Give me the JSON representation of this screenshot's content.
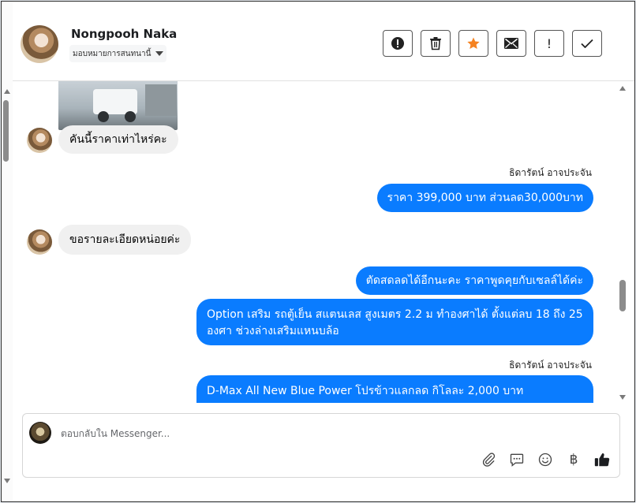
{
  "contact": {
    "name": "Nongpooh Naka",
    "assignment": "มอบหมายการสนทนานี้"
  },
  "toolbar": {
    "spam_label": "!",
    "important_label": "!"
  },
  "messages": {
    "in1": "คันนี้ราคาเท่าไหร่คะ",
    "sender1": "ธิดารัตน์ อาจประจัน",
    "out1": "ราคา 399,000 บาท ส่วนลด30,000บาท",
    "in2": "ขอรายละเอียดหน่อยค่ะ",
    "out2": "ตัดสดลดได้อีกนะคะ ราคาพูดคุยกับเซลล์ได้ค่ะ",
    "out3": "Option เสริม รถตู้เย็น สแตนเลส สูงเมตร 2.2 ม ทำองศาได้ ตั้งแต่ลบ 18 ถึง 25 องศา ช่วงล่างเสริมแหนบล้อ",
    "sender2": "ธิดารัตน์ อาจประจัน",
    "out4": "D-Max All New Blue Power โปรข้าวแลกลด กิโลละ 2,000 บาท"
  },
  "composer": {
    "placeholder": "ตอบกลับใน Messenger...",
    "currency_symbol": "฿"
  },
  "icons": {
    "toolbar": [
      "alert-circle-icon",
      "trash-icon",
      "star-icon",
      "envelope-icon",
      "exclamation-icon",
      "check-icon"
    ],
    "composer": [
      "paperclip-icon",
      "saved-reply-icon",
      "emoji-icon",
      "baht-icon",
      "thumbs-up-icon"
    ]
  },
  "colors": {
    "outgoing_bubble": "#0a7cff",
    "incoming_bubble": "#f0f0f0",
    "star": "#f58220",
    "like": "#1c1e21"
  }
}
